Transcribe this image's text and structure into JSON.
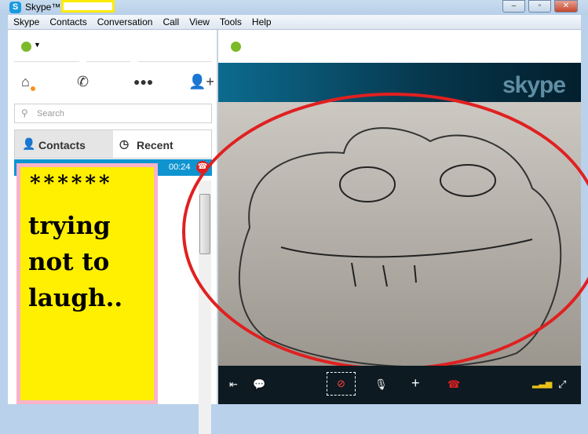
{
  "window": {
    "title": "Skype™ -",
    "minimize": "–",
    "maximize": "▫",
    "close": "✕"
  },
  "menu": [
    "Skype",
    "Contacts",
    "Conversation",
    "Call",
    "View",
    "Tools",
    "Help"
  ],
  "nav": {
    "home": "home-icon",
    "call": "phone-icon",
    "groups": "group-icon",
    "add_contact": "add-contact-icon"
  },
  "search": {
    "placeholder": "Search"
  },
  "tabs": {
    "contacts": "Contacts",
    "recent": "Recent"
  },
  "call": {
    "duration": "00:24"
  },
  "note": {
    "stars": "******",
    "lines": [
      "trying",
      "not to",
      "laugh.."
    ]
  },
  "video": {
    "watermark": "skype"
  },
  "colors": {
    "accent": "#0f94d0",
    "status": "#7cba2a",
    "annotation": "#e02020",
    "note": "#ffef00"
  }
}
